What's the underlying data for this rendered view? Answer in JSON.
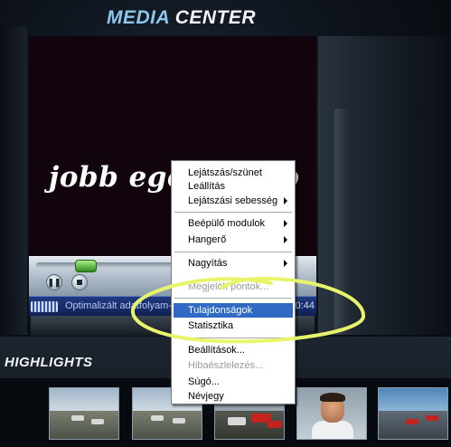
{
  "app": {
    "title_part1": "MEDIA",
    "title_part2": "CENTER"
  },
  "video": {
    "overlay_text": "jobb egér gomb"
  },
  "player": {
    "seek_progress": 0.3,
    "pause_icon": "pause-icon",
    "stop_icon": "stop-icon",
    "status_text": "Optimalizált adatfolyam-ke",
    "time": "0:44"
  },
  "highlights": {
    "title": "HIGHLIGHTS",
    "thumbnails": [
      {
        "scene": "race-track"
      },
      {
        "scene": "race-track"
      },
      {
        "scene": "race-cars-pack"
      },
      {
        "scene": "driver-portrait"
      },
      {
        "scene": "pit-lane"
      }
    ]
  },
  "context_menu": {
    "items": [
      {
        "label": "Lejátszás/szünet",
        "submenu": false,
        "disabled": false
      },
      {
        "label": "Leállítás",
        "submenu": false,
        "disabled": false
      },
      {
        "label": "Lejátszási sebesség",
        "submenu": true,
        "disabled": false
      },
      {
        "label": "Beépülő modulok",
        "submenu": true,
        "disabled": false
      },
      {
        "label": "Hangerő",
        "submenu": true,
        "disabled": false
      },
      {
        "label": "Nagyítás",
        "submenu": true,
        "disabled": false
      },
      {
        "label": "Megjelölt pontok...",
        "submenu": false,
        "disabled": true
      },
      {
        "label": "Tulajdonságok",
        "submenu": false,
        "disabled": false,
        "selected": true
      },
      {
        "label": "Statisztika",
        "submenu": false,
        "disabled": false
      },
      {
        "label": "Beállítások...",
        "submenu": false,
        "disabled": false
      },
      {
        "label": "Hibaészlelezés...",
        "submenu": false,
        "disabled": true
      },
      {
        "label": "Súgó...",
        "submenu": false,
        "disabled": false
      },
      {
        "label": "Névjegy",
        "submenu": false,
        "disabled": false
      }
    ]
  },
  "colors": {
    "annotation_stroke": "#e8f56a",
    "menu_highlight": "#316ac5"
  }
}
